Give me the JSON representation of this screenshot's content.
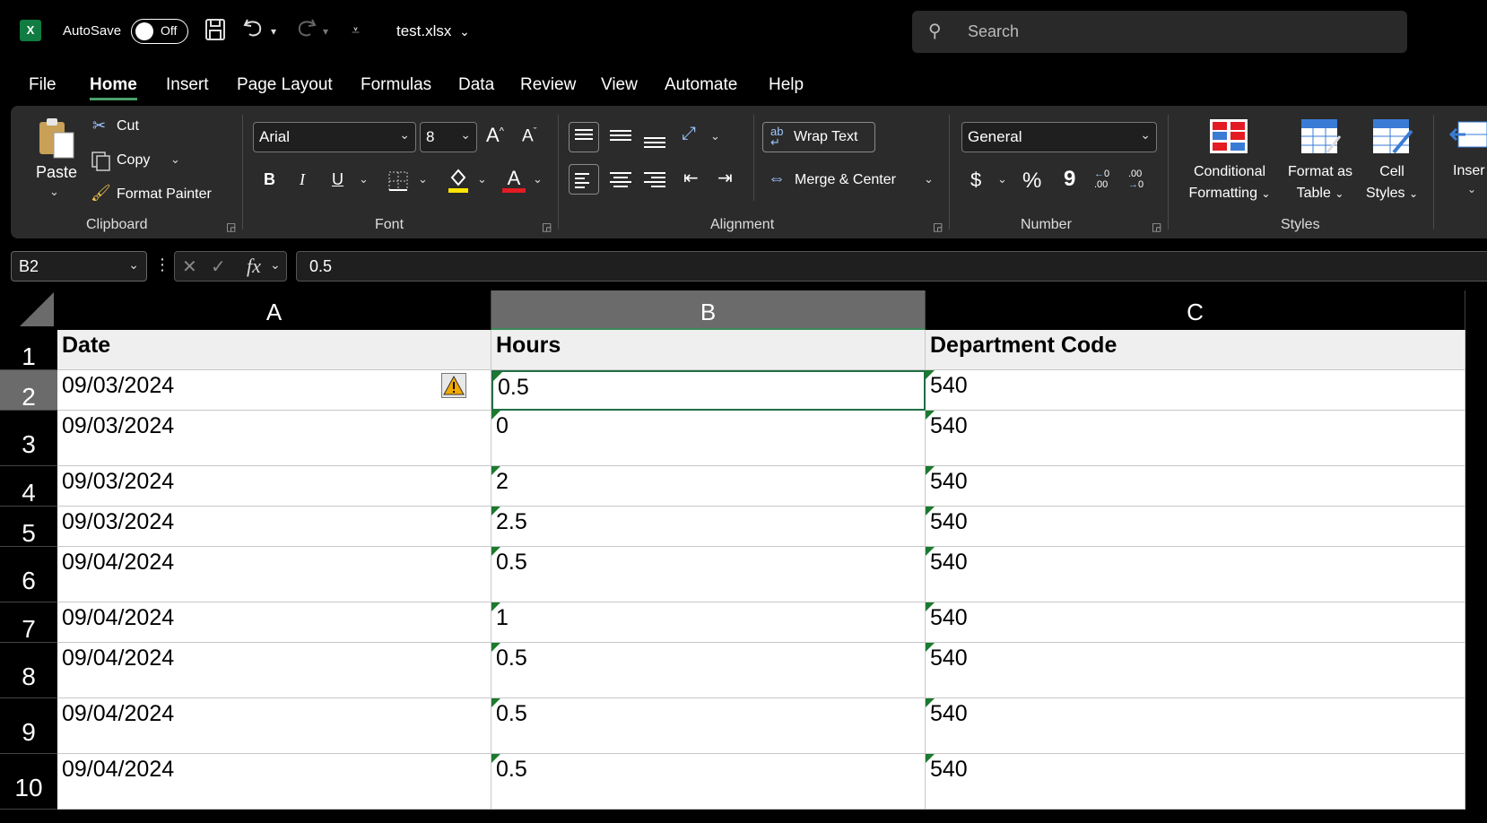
{
  "titlebar": {
    "app_icon": "excel-icon",
    "autosave_label": "AutoSave",
    "autosave_state": "Off",
    "filename": "test.xlsx",
    "search_placeholder": "Search"
  },
  "tabs": [
    "File",
    "Home",
    "Insert",
    "Page Layout",
    "Formulas",
    "Data",
    "Review",
    "View",
    "Automate",
    "Help"
  ],
  "active_tab": "Home",
  "ribbon": {
    "clipboard": {
      "paste": "Paste",
      "cut": "Cut",
      "copy": "Copy",
      "format_painter": "Format Painter",
      "label": "Clipboard"
    },
    "font": {
      "name": "Arial",
      "size": "8",
      "label": "Font",
      "bold": "B",
      "italic": "I",
      "underline": "U",
      "grow": "A",
      "shrink": "A",
      "font_color_letter": "A"
    },
    "alignment": {
      "wrap_text": "Wrap Text",
      "merge_center": "Merge & Center",
      "label": "Alignment"
    },
    "number": {
      "format": "General",
      "currency": "$",
      "percent": "%",
      "comma": "9",
      "label": "Number"
    },
    "styles": {
      "conditional_1": "Conditional",
      "conditional_2": "Formatting",
      "format_table_1": "Format as",
      "format_table_2": "Table",
      "cell_styles_1": "Cell",
      "cell_styles_2": "Styles",
      "label": "Styles"
    },
    "cells": {
      "insert": "Inser"
    }
  },
  "formula_bar": {
    "name_box": "B2",
    "fx": "fx",
    "value": "0.5"
  },
  "colors": {
    "accent": "#107c41",
    "selection": "#1f6f43",
    "error_indicator": "#1a7a2e"
  },
  "sheet": {
    "columns": [
      "A",
      "B",
      "C"
    ],
    "rows": [
      {
        "num": "1",
        "a": "Date",
        "b": "Hours",
        "c": "Department Code"
      },
      {
        "num": "2",
        "a": "09/03/2024",
        "b": "0.5",
        "c": "540"
      },
      {
        "num": "3",
        "a": "09/03/2024",
        "b": "0",
        "c": "540"
      },
      {
        "num": "4",
        "a": "09/03/2024",
        "b": "2",
        "c": "540"
      },
      {
        "num": "5",
        "a": "09/03/2024",
        "b": "2.5",
        "c": "540"
      },
      {
        "num": "6",
        "a": "09/04/2024",
        "b": "0.5",
        "c": "540"
      },
      {
        "num": "7",
        "a": "09/04/2024",
        "b": "1",
        "c": "540"
      },
      {
        "num": "8",
        "a": "09/04/2024",
        "b": "0.5",
        "c": "540"
      },
      {
        "num": "9",
        "a": "09/04/2024",
        "b": "0.5",
        "c": "540"
      },
      {
        "num": "10",
        "a": "09/04/2024",
        "b": "0.5",
        "c": "540"
      }
    ]
  }
}
